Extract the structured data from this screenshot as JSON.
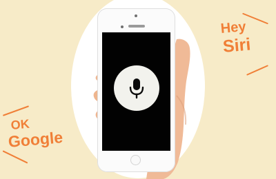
{
  "illustration": {
    "left_callout": {
      "line1": "OK",
      "line2": "Google"
    },
    "right_callout": {
      "line1": "Hey",
      "line2": "Siri"
    },
    "phone_screen": {
      "icon": "microphone-icon"
    }
  },
  "colors": {
    "background": "#f7ebc8",
    "accent": "#f07f37",
    "phone_screen": "#020202",
    "mic_circle": "#f2f2ed"
  }
}
